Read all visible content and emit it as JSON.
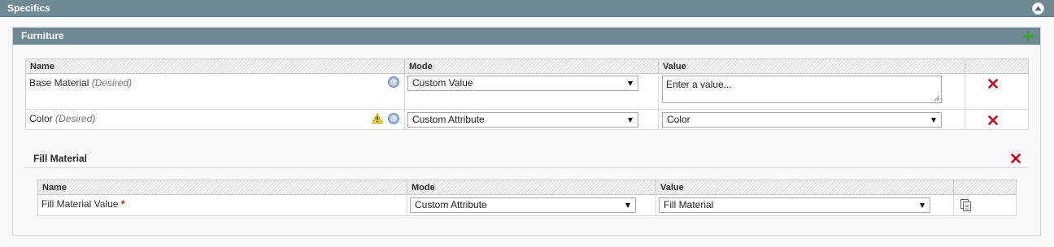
{
  "specifics": {
    "title": "Specifics",
    "collapse_icon": "collapse-up-icon"
  },
  "furniture": {
    "title": "Furniture",
    "add_icon": "plus-icon",
    "columns": {
      "name": "Name",
      "mode": "Mode",
      "value": "Value"
    },
    "rows": [
      {
        "name": "Base Material",
        "tag": "(Desired)",
        "mode": "Custom Value",
        "value_placeholder": "Enter a value..."
      },
      {
        "name": "Color",
        "tag": "(Desired)",
        "mode": "Custom Attribute",
        "value": "Color"
      }
    ]
  },
  "fill_material": {
    "title": "Fill Material",
    "columns": {
      "name": "Name",
      "mode": "Mode",
      "value": "Value"
    },
    "rows": [
      {
        "name": "Fill Material Value",
        "required_mark": "*",
        "mode": "Custom Attribute",
        "value": "Fill Material"
      }
    ]
  },
  "colors": {
    "header_bg": "#6f8992",
    "delete": "#d0021b",
    "add": "#3aa935",
    "required": "#d40707"
  }
}
